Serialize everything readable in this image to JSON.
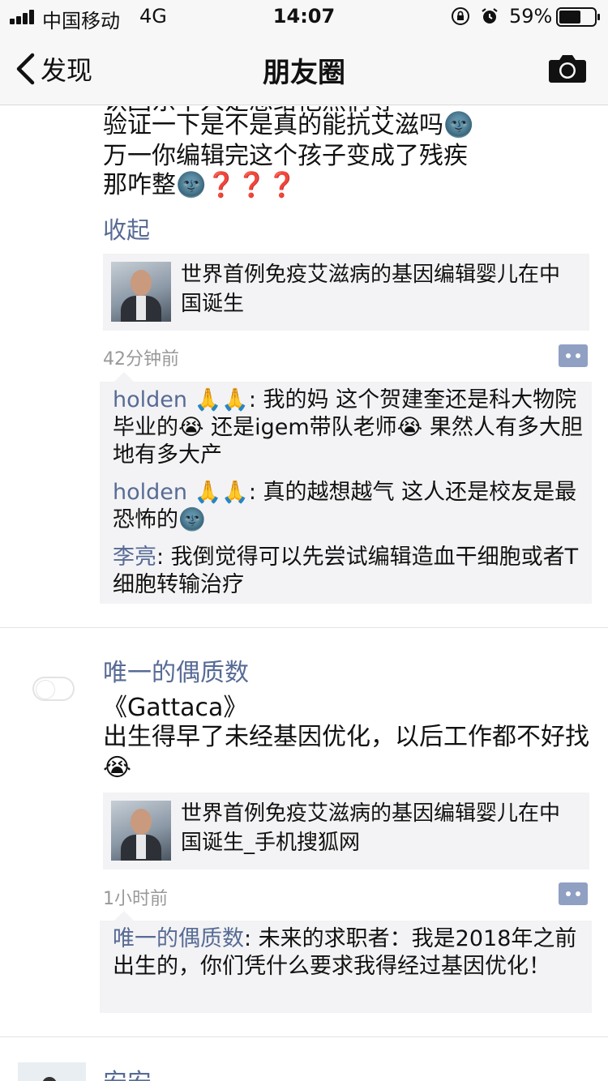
{
  "status_bar": {
    "carrier": "中国移动",
    "network": "4G",
    "time": "14:07",
    "battery": "59%",
    "icons": [
      "signal-icon",
      "orientation-lock-icon",
      "alarm-icon",
      "battery-icon"
    ]
  },
  "nav": {
    "back_label": "发现",
    "title": "朋友圈",
    "back_icon": "chevron-left-icon",
    "camera_icon": "camera-icon"
  },
  "post1": {
    "text_cut_off": "认国东不人是想给他然们等",
    "text_lines": [
      "验证一下是不是真的能抗艾滋吗🌚",
      "万一你编辑完这个孩子变成了残疾",
      "那咋整🌚❓❓❓"
    ],
    "collapse_label": "收起",
    "link_title": "世界首例免疫艾滋病的基因编辑婴儿在中国诞生",
    "time": "42分钟前",
    "comments": [
      {
        "author": "holden 🙏🙏",
        "text": ": 我的妈 这个贺建奎还是科大物院毕业的😭 还是igem带队老师😭 果然人有多大胆 地有多大产"
      },
      {
        "author": "holden 🙏🙏",
        "text": ": 真的越想越气 这人还是校友是最恐怖的🌚"
      },
      {
        "author": "李亮",
        "text": ": 我倒觉得可以先尝试编辑造血干细胞或者T细胞转输治疗"
      }
    ]
  },
  "post2": {
    "author": "唯一的偶质数",
    "text_lines": [
      "《Gattaca》",
      "出生得早了未经基因优化，以后工作都不好找😭"
    ],
    "link_title": "世界首例免疫艾滋病的基因编辑婴儿在中国诞生_手机搜狐网",
    "time": "1小时前",
    "comments": [
      {
        "author": "唯一的偶质数",
        "text": ": 未来的求职者：我是2018年之前出生的，你们凭什么要求我得经过基因优化！"
      }
    ]
  },
  "post3": {
    "author": "安安"
  },
  "colors": {
    "link_blue": "#576b95",
    "bar_bg": "#f7f7f7",
    "card_bg": "#f3f3f5",
    "meta_gray": "#999999"
  }
}
